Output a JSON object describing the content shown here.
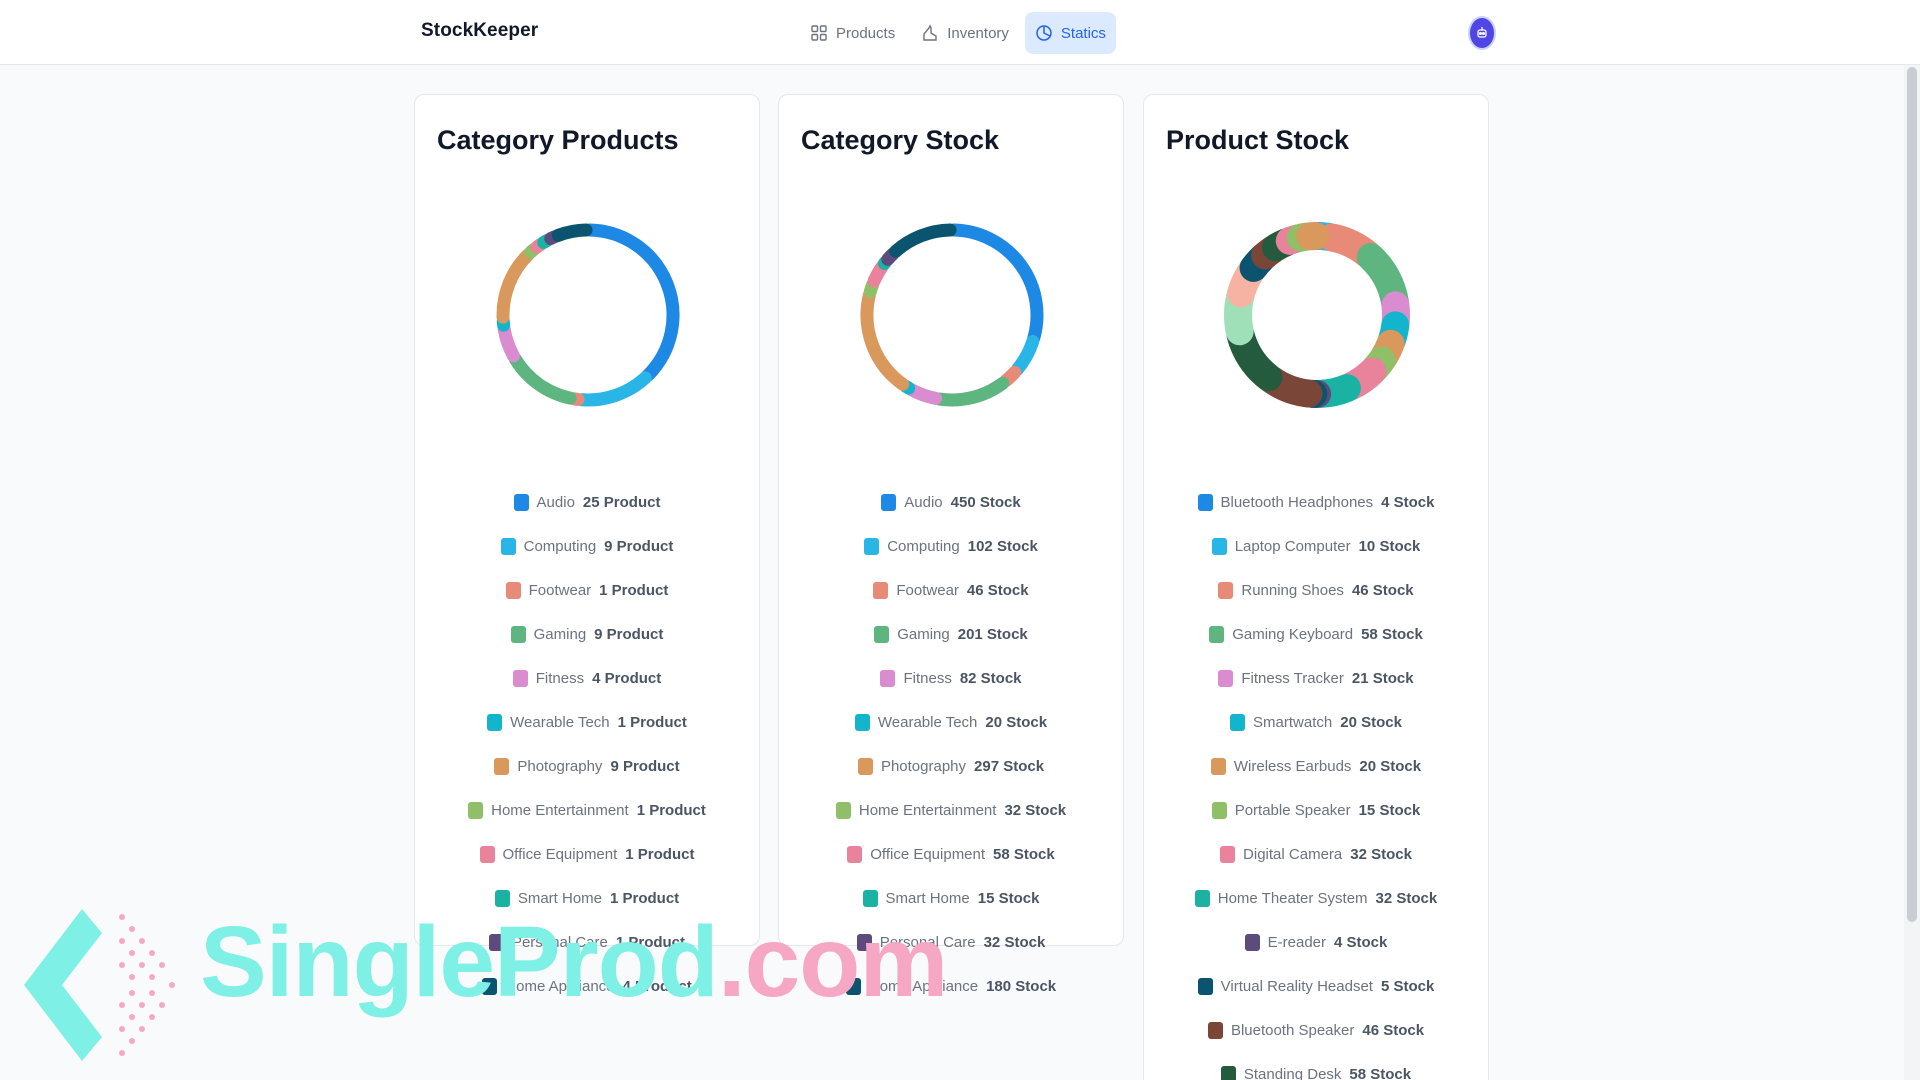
{
  "app": {
    "title": "StockKeeper"
  },
  "nav": [
    {
      "label": "Products",
      "icon": "grid-icon",
      "active": false
    },
    {
      "label": "Inventory",
      "icon": "inventory-icon",
      "active": false
    },
    {
      "label": "Statics",
      "icon": "pie-chart-icon",
      "active": true
    }
  ],
  "user": {
    "avatar_icon": "robot-avatar-icon",
    "color": "#4f46e5"
  },
  "colors": {
    "blue": "#1e88e5",
    "sky": "#29b6e6",
    "salmon": "#e88a78",
    "green": "#5fb580",
    "orchid": "#d98ccf",
    "cyan": "#12b5cb",
    "tan": "#d9985c",
    "olive": "#8fbf66",
    "pink": "#e9829b",
    "teal": "#1ab3a3",
    "purple": "#5e4b7d",
    "navy": "#0b5470",
    "brown": "#7a4638",
    "darkgreen": "#245a3e",
    "mint": "#9fe0b8",
    "peach": "#f6b3a3"
  },
  "cards": [
    {
      "title": "Category Products",
      "unit": "Product",
      "items": [
        {
          "name": "Audio",
          "value": 25,
          "color": "#1e88e5"
        },
        {
          "name": "Computing",
          "value": 9,
          "color": "#29b6e6"
        },
        {
          "name": "Footwear",
          "value": 1,
          "color": "#e88a78"
        },
        {
          "name": "Gaming",
          "value": 9,
          "color": "#5fb580"
        },
        {
          "name": "Fitness",
          "value": 4,
          "color": "#d98ccf"
        },
        {
          "name": "Wearable Tech",
          "value": 1,
          "color": "#12b5cb"
        },
        {
          "name": "Photography",
          "value": 9,
          "color": "#d9985c"
        },
        {
          "name": "Home Entertainment",
          "value": 1,
          "color": "#8fbf66"
        },
        {
          "name": "Office Equipment",
          "value": 1,
          "color": "#e9829b"
        },
        {
          "name": "Smart Home",
          "value": 1,
          "color": "#1ab3a3"
        },
        {
          "name": "Personal Care",
          "value": 1,
          "color": "#5e4b7d"
        },
        {
          "name": "Home Appliance",
          "value": 4,
          "color": "#0b5470"
        }
      ]
    },
    {
      "title": "Category Stock",
      "unit": "Stock",
      "items": [
        {
          "name": "Audio",
          "value": 450,
          "color": "#1e88e5"
        },
        {
          "name": "Computing",
          "value": 102,
          "color": "#29b6e6"
        },
        {
          "name": "Footwear",
          "value": 46,
          "color": "#e88a78"
        },
        {
          "name": "Gaming",
          "value": 201,
          "color": "#5fb580"
        },
        {
          "name": "Fitness",
          "value": 82,
          "color": "#d98ccf"
        },
        {
          "name": "Wearable Tech",
          "value": 20,
          "color": "#12b5cb"
        },
        {
          "name": "Photography",
          "value": 297,
          "color": "#d9985c"
        },
        {
          "name": "Home Entertainment",
          "value": 32,
          "color": "#8fbf66"
        },
        {
          "name": "Office Equipment",
          "value": 58,
          "color": "#e9829b"
        },
        {
          "name": "Smart Home",
          "value": 15,
          "color": "#1ab3a3"
        },
        {
          "name": "Personal Care",
          "value": 32,
          "color": "#5e4b7d"
        },
        {
          "name": "Home Appliance",
          "value": 180,
          "color": "#0b5470"
        }
      ]
    },
    {
      "title": "Product Stock",
      "unit": "Stock",
      "items": [
        {
          "name": "Bluetooth Headphones",
          "value": 4,
          "color": "#1e88e5"
        },
        {
          "name": "Laptop Computer",
          "value": 10,
          "color": "#29b6e6"
        },
        {
          "name": "Running Shoes",
          "value": 46,
          "color": "#e88a78"
        },
        {
          "name": "Gaming Keyboard",
          "value": 58,
          "color": "#5fb580"
        },
        {
          "name": "Fitness Tracker",
          "value": 21,
          "color": "#d98ccf"
        },
        {
          "name": "Smartwatch",
          "value": 20,
          "color": "#12b5cb"
        },
        {
          "name": "Wireless Earbuds",
          "value": 20,
          "color": "#d9985c"
        },
        {
          "name": "Portable Speaker",
          "value": 15,
          "color": "#8fbf66"
        },
        {
          "name": "Digital Camera",
          "value": 32,
          "color": "#e9829b"
        },
        {
          "name": "Home Theater System",
          "value": 32,
          "color": "#1ab3a3"
        },
        {
          "name": "E-reader",
          "value": 4,
          "color": "#5e4b7d"
        },
        {
          "name": "Virtual Reality Headset",
          "value": 5,
          "color": "#0b5470"
        },
        {
          "name": "Bluetooth Speaker",
          "value": 46,
          "color": "#7a4638"
        },
        {
          "name": "Standing Desk",
          "value": 58,
          "color": "#245a3e"
        }
      ],
      "extra_ring_slices": [
        {
          "value": 40,
          "color": "#9fe0b8"
        },
        {
          "value": 30,
          "color": "#f6b3a3"
        },
        {
          "value": 18,
          "color": "#0b5470"
        },
        {
          "value": 14,
          "color": "#7a4638"
        },
        {
          "value": 16,
          "color": "#245a3e"
        },
        {
          "value": 12,
          "color": "#e9829b"
        },
        {
          "value": 10,
          "color": "#8fbf66"
        },
        {
          "value": 9,
          "color": "#d9985c"
        }
      ]
    }
  ],
  "watermark": {
    "part1": "SingleProd",
    "part2": ".com"
  }
}
